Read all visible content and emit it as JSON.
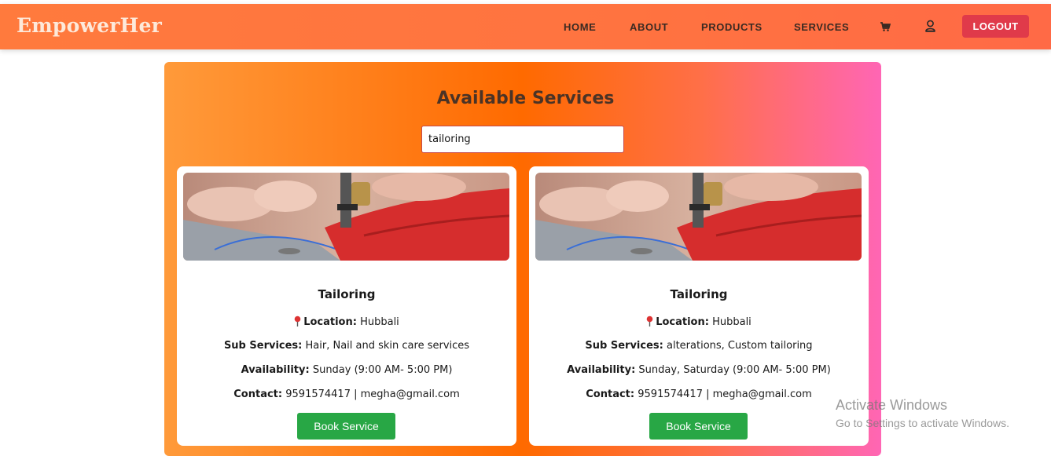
{
  "brand": "EmpowerHer",
  "nav": {
    "home": "HOME",
    "about": "ABOUT",
    "products": "PRODUCTS",
    "services": "SERVICES",
    "logout": "LOGOUT",
    "cart_icon": "cart-icon",
    "profile_icon": "user-icon"
  },
  "main": {
    "title": "Available Services",
    "search_value": "tailoring"
  },
  "labels": {
    "location": "Location:",
    "sub_services": "Sub Services:",
    "availability": "Availability:",
    "contact": "Contact:",
    "book": "Book Service"
  },
  "services": [
    {
      "title": "Tailoring",
      "location": "Hubbali",
      "sub_services": "Hair, Nail and skin care services",
      "availability": "Sunday (9:00 AM- 5:00 PM)",
      "contact": "9591574417 | megha@gmail.com"
    },
    {
      "title": "Tailoring",
      "location": "Hubbali",
      "sub_services": "alterations, Custom tailoring",
      "availability": "Sunday, Saturday (9:00 AM- 5:00 PM)",
      "contact": "9591574417 | megha@gmail.com"
    }
  ],
  "watermark": {
    "title": "Activate Windows",
    "subtitle": "Go to Settings to activate Windows."
  },
  "colors": {
    "navbar": "#ff7340",
    "logout": "#e03a4a",
    "book_button": "#28a745"
  }
}
